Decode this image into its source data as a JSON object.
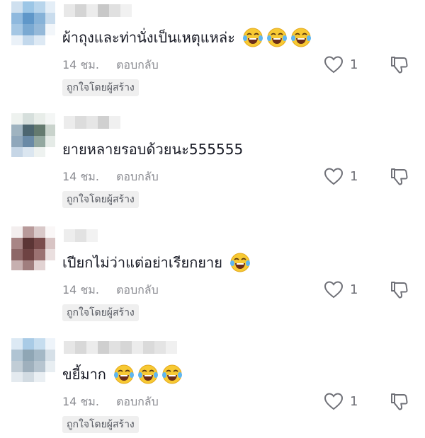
{
  "comments": [
    {
      "text": "ผ้าถุงและท่านั่งเป็นเหตุแหล่ะ",
      "emoji_count": 3,
      "emoji": "face-with-tears-of-joy-icon",
      "time": "14 ชม.",
      "reply_label": "ตอบกลับ",
      "badge": "ถูกใจโดยผู้สร้าง",
      "likes": "1"
    },
    {
      "text": "ยายหลายรอบด้วยนะ555555",
      "emoji_count": 0,
      "time": "14 ชม.",
      "reply_label": "ตอบกลับ",
      "badge": "ถูกใจโดยผู้สร้าง",
      "likes": "1"
    },
    {
      "text": "เปียกไม่ว่าแต่อย่าเรียกยาย",
      "emoji_count": 1,
      "emoji": "face-with-tears-of-joy-icon",
      "time": "14 ชม.",
      "reply_label": "ตอบกลับ",
      "badge": "ถูกใจโดยผู้สร้าง",
      "likes": "1"
    },
    {
      "text": "ขยี้มาก",
      "emoji_count": 3,
      "emoji": "face-with-tears-of-joy-icon",
      "time": "14 ชม.",
      "reply_label": "ตอบกลับ",
      "badge": "ถูกใจโดยผู้สร้าง",
      "likes": "1"
    }
  ],
  "colors": {
    "text": "#161823",
    "muted": "#8a8b91",
    "badge_bg": "#efefef",
    "icon": "#6f7077"
  }
}
